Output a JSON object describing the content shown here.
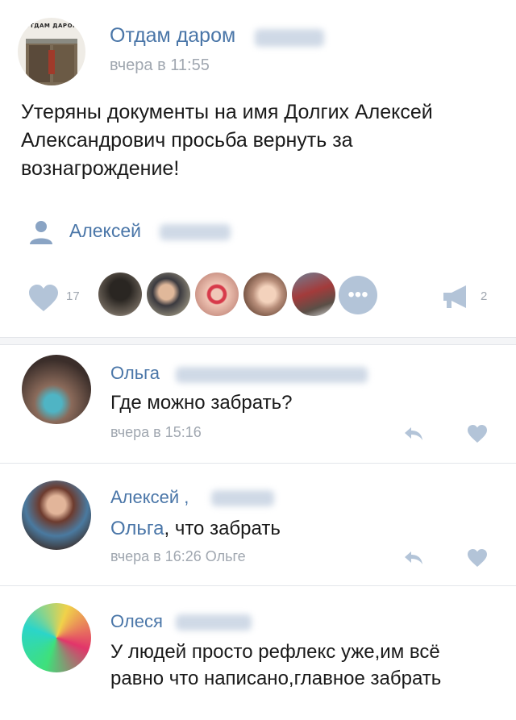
{
  "post": {
    "group_logo_text": "ОТДАМ ДАРОМ",
    "group_name": "Отдам даром",
    "time": "вчера в 11:55",
    "text": "Утеряны документы на имя Долгих Алексей Александрович просьба вернуть за вознагрождение!",
    "author": "Алексей",
    "likes_count": "17",
    "shares_count": "2",
    "more_glyph": "•••"
  },
  "comments": [
    {
      "name": "Ольга",
      "text": "Где можно забрать?",
      "time": "вчера в 15:16"
    },
    {
      "name": "Алексей ,",
      "mention": "Ольга",
      "text": ", что забрать",
      "time": "вчера в 16:26 Ольге"
    },
    {
      "name": "Олеся",
      "text": "У людей просто рефлекс уже,им всё равно что написано,главное забрать"
    }
  ],
  "colors": {
    "link": "#4a76a8",
    "muted": "#a0a7b0",
    "icon": "#b3c4d8"
  }
}
